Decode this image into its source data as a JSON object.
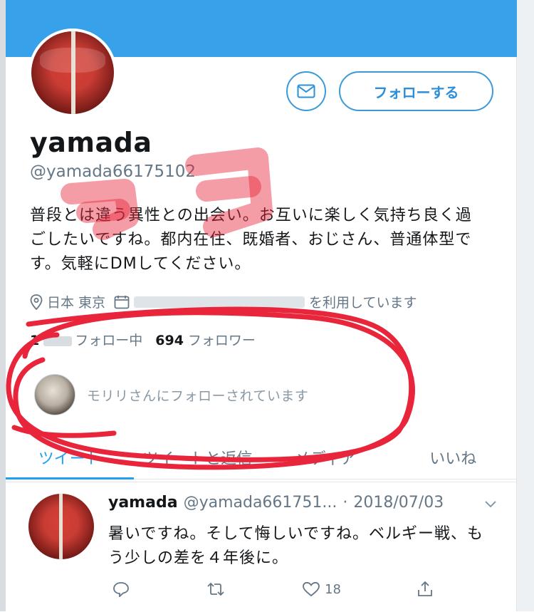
{
  "profile": {
    "name": "yamada",
    "handle": "@yamada66175102",
    "bio": "普段とは違う異性との出会い。お互いに楽しく気持ち良く過ごしたいですね。都内在住、既婚者、おじさん、普通体型です。気軽にDMしてください。",
    "location": "日本 東京",
    "joined": "を利用しています",
    "following_count": "1",
    "following_label": "フォロー中",
    "followers_count": "694",
    "followers_label": "フォロワー",
    "followed_by": "モリリさんにフォローされています"
  },
  "buttons": {
    "follow_label": "フォローする"
  },
  "tabs": [
    {
      "label": "ツイート"
    },
    {
      "label": "ツイートと返信"
    },
    {
      "label": "メディア"
    },
    {
      "label": "いいね"
    }
  ],
  "tweet": {
    "name": "yamada",
    "handle": "@yamada661751...",
    "separator": "·",
    "date": "2018/07/03",
    "text": "暑いですね。そして悔しいですね。ベルギー戦、もう少しの差を４年後に。",
    "like_count": "18"
  },
  "annotation": {
    "handwritten_text": "ココ",
    "color": "#e8253a"
  },
  "colors": {
    "banner": "#37a1ea",
    "accent": "#1da1f2"
  },
  "icons": [
    "mail-icon",
    "location-icon",
    "calendar-icon",
    "reply-icon",
    "retweet-icon",
    "like-icon",
    "share-icon",
    "chevron-down-icon"
  ]
}
